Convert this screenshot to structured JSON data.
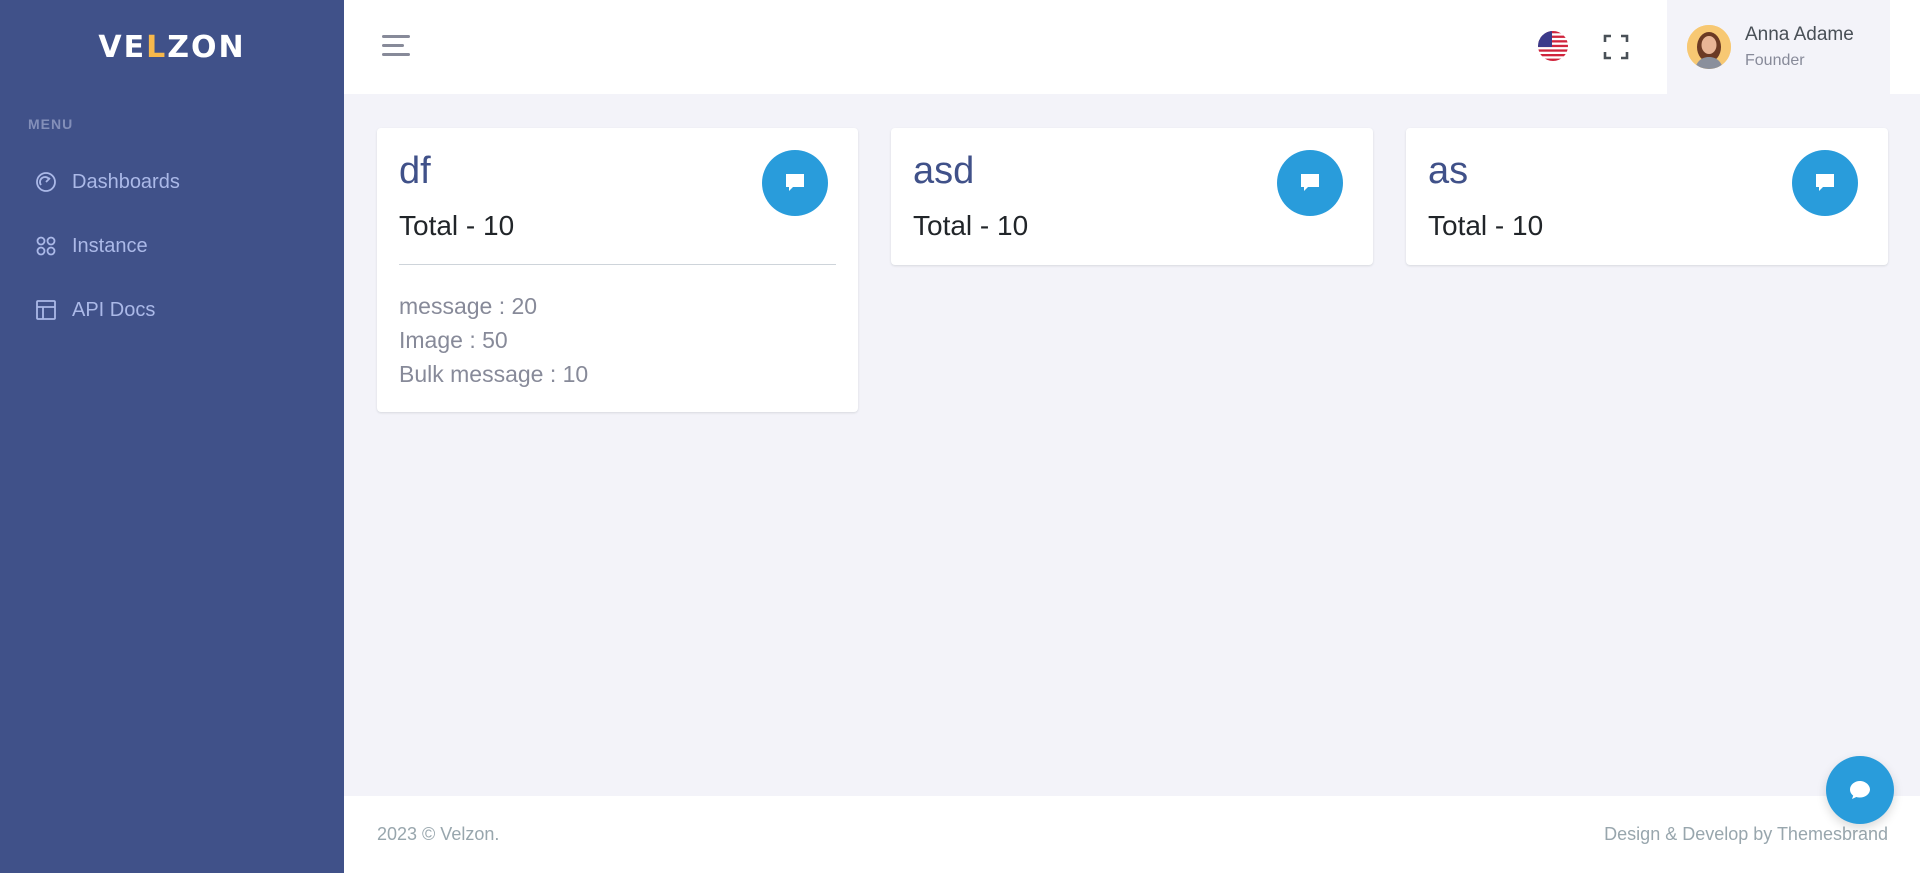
{
  "brand": {
    "logo_prefix": "ve",
    "logo_dot": "l",
    "logo_suffix": "zon"
  },
  "sidebar": {
    "menu_title": "MENU",
    "items": [
      {
        "label": "Dashboards",
        "icon": "dashboard-gauge-icon"
      },
      {
        "label": "Instance",
        "icon": "apps-grid-icon"
      },
      {
        "label": "API Docs",
        "icon": "layout-icon"
      }
    ]
  },
  "topbar": {
    "user": {
      "name": "Anna Adame",
      "role": "Founder"
    }
  },
  "cards": [
    {
      "title": "df",
      "total": "Total - 10",
      "stats": [
        "message : 20",
        "Image : 50",
        "Bulk message : 10"
      ]
    },
    {
      "title": "asd",
      "total": "Total - 10"
    },
    {
      "title": "as",
      "total": "Total - 10"
    }
  ],
  "footer": {
    "copyright": "2023 © Velzon.",
    "credit": "Design & Develop by Themesbrand"
  },
  "colors": {
    "sidebar": "#405189",
    "accent": "#299cdb",
    "background": "#f3f3f9"
  }
}
